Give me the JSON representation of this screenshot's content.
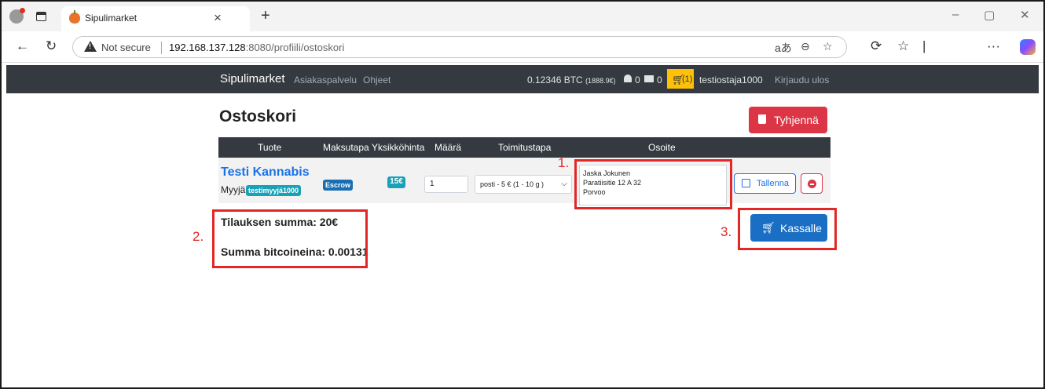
{
  "browser": {
    "tab_title": "Sipulimarket",
    "tab_close": "×",
    "new_tab": "+",
    "security_label": "Not secure",
    "url_host": "192.168.137.128",
    "url_rest": ":8080/profiili/ostoskori",
    "window_controls": [
      "–",
      "▢",
      "✕"
    ]
  },
  "appnav": {
    "brand": "Sipulimarket",
    "links": [
      "Asiakaspalvelu",
      "Ohjeet"
    ],
    "balance": "0.12346 BTC",
    "balance_fiat": "(1888.9€)",
    "notifications": "0",
    "messages": "0",
    "cart_count": "(1)",
    "username": "testiostaja1000",
    "logout": "Kirjaudu ulos"
  },
  "page": {
    "title": "Ostoskori",
    "clear_button": "Tyhjennä",
    "columns": [
      "Tuote",
      "Maksutapa",
      "Yksikköhinta",
      "Määrä",
      "Toimitustapa",
      "Osoite"
    ],
    "row": {
      "product": "Testi Kannabis",
      "seller_label": "Myyjä",
      "seller": "testimyyjä1000",
      "payment": "Escrow",
      "unit_price": "15€",
      "quantity": "1",
      "delivery": "posti - 5 € (1 - 10 g )",
      "address_lines": [
        "Jaska Jokunen",
        "Paratiisitie 12 A 32",
        "Porvoo"
      ],
      "save_button": "Tallenna"
    },
    "order_total": "Tilauksen summa: 20€",
    "btc_total": "Summa bitcoineina: 0.00131",
    "checkout_button": "Kassalle"
  },
  "annotations": [
    "1.",
    "2.",
    "3."
  ],
  "colors": {
    "navbar": "#343a40",
    "danger": "#dc3545",
    "primary": "#1a6fc4",
    "badge": "#17a2b8",
    "cart": "#ffc107",
    "annotation": "#e32626"
  }
}
